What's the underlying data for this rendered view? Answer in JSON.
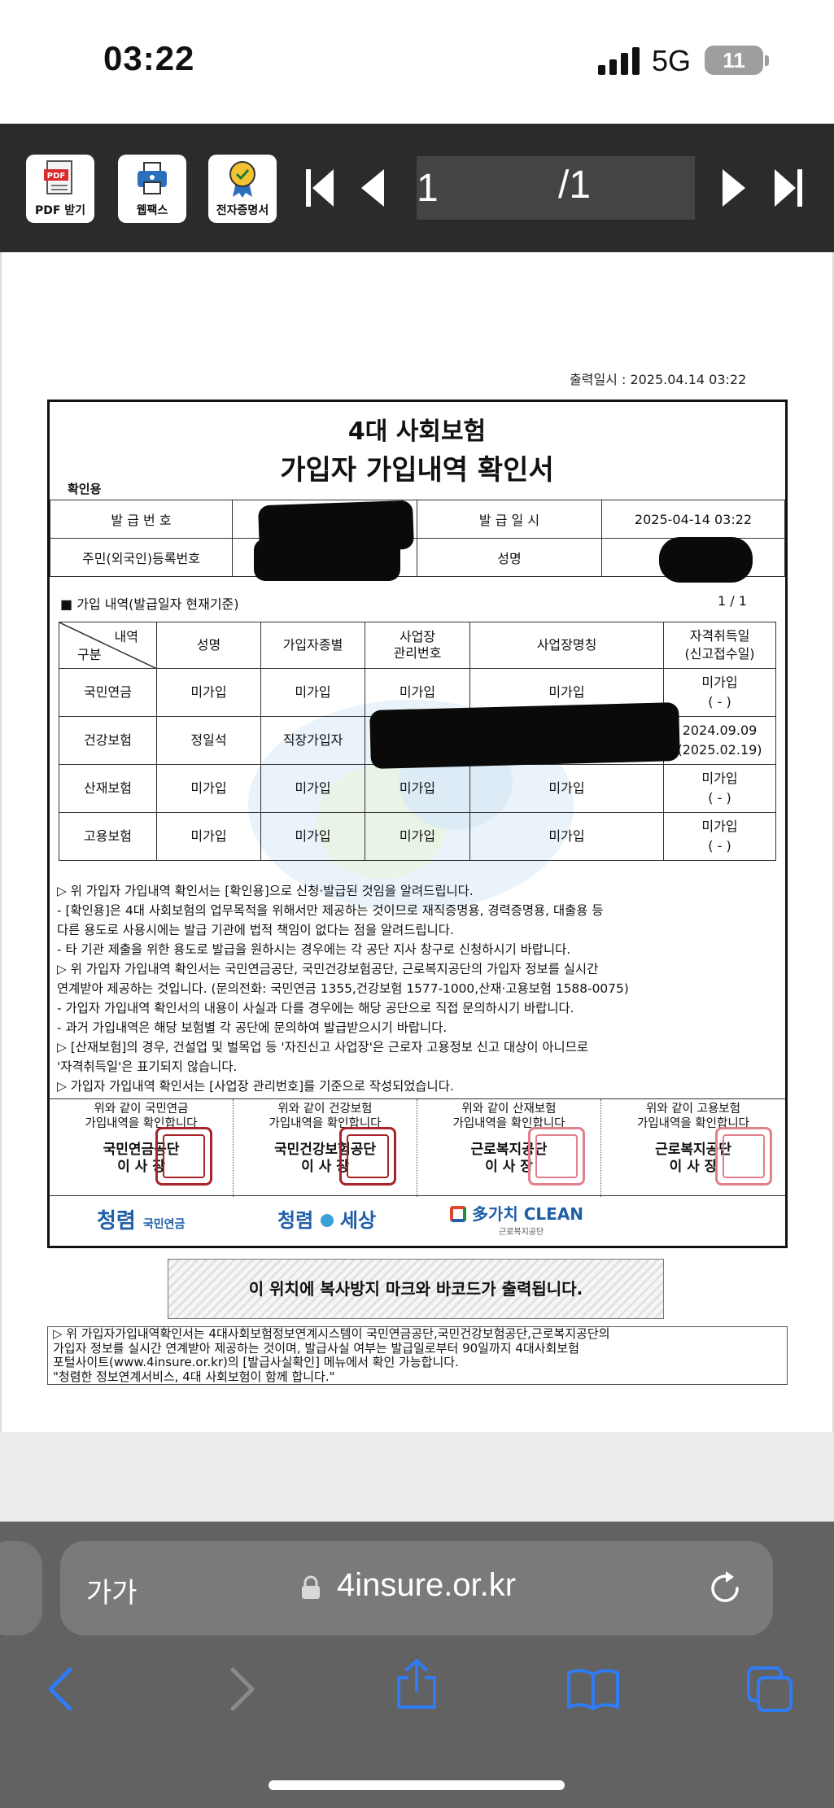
{
  "status_bar": {
    "time": "03:22",
    "network": "5G",
    "battery": "11"
  },
  "toolbar": {
    "pdf_label": "PDF 받기",
    "fax_label": "웹팩스",
    "cert_label": "전자증명서",
    "page_current": "1",
    "page_total": "/1"
  },
  "doc": {
    "print_date": "출력일시 : 2025.04.14 03:22",
    "title1": "4대 사회보험",
    "title2": "가입자 가입내역 확인서",
    "tag": "확인용",
    "info": {
      "issue_no_label": "발 급 번 호",
      "issue_date_label": "발 급 일 시",
      "issue_date": "2025-04-14 03:22",
      "reg_no_label": "주민(외국인)등록번호",
      "name_label": "성명"
    },
    "section_title": "■ 가입 내역(발급일자 현재기준)",
    "section_page": "1   /   1",
    "grid": {
      "corner_top": "내역",
      "corner_bottom": "구분",
      "headers": [
        "성명",
        "가입자종별",
        "사업장\n관리번호",
        "사업장명칭",
        "자격취득일\n(신고접수일)"
      ],
      "rows": [
        {
          "type": "국민연금",
          "name": "미가입",
          "kind": "미가입",
          "biz_no": "미가입",
          "biz_name": "미가입",
          "date1": "미가입",
          "date2": "( - )"
        },
        {
          "type": "건강보험",
          "name": "정일석",
          "kind": "직장가입자",
          "biz_no": "",
          "biz_name": "",
          "date1": "2024.09.09",
          "date2": "(2025.02.19)"
        },
        {
          "type": "산재보험",
          "name": "미가입",
          "kind": "미가입",
          "biz_no": "미가입",
          "biz_name": "미가입",
          "date1": "미가입",
          "date2": "( - )"
        },
        {
          "type": "고용보험",
          "name": "미가입",
          "kind": "미가입",
          "biz_no": "미가입",
          "biz_name": "미가입",
          "date1": "미가입",
          "date2": "( - )"
        }
      ]
    },
    "notes": [
      "▷ 위 가입자 가입내역 확인서는 [확인용]으로 신청·발급된 것임을 알려드립니다.",
      " - [확인용]은 4대 사회보험의 업무목적을 위해서만 제공하는 것이므로 재직증명용, 경력증명용, 대출용 등",
      "   다른 용도로 사용시에는 발급 기관에 법적 책임이 없다는 점을 알려드립니다.",
      " - 타 기관 제출을 위한 용도로 발급을 원하시는 경우에는 각 공단 지사 창구로 신청하시기 바랍니다.",
      "▷ 위 가입자 가입내역 확인서는 국민연금공단, 국민건강보험공단, 근로복지공단의 가입자 정보를 실시간",
      "   연계받아 제공하는 것입니다. (문의전화: 국민연금 1355,건강보험 1577-1000,산재·고용보험 1588-0075)",
      " - 가입자 가입내역 확인서의 내용이 사실과 다를 경우에는 해당 공단으로 직접 문의하시기 바랍니다.",
      " - 과거 가입내역은 해당 보험별 각 공단에 문의하여 발급받으시기 바랍니다.",
      "▷ [산재보험]의 경우, 건설업 및 벌목업 등 '자진신고 사업장'은 근로자 고용정보 신고 대상이 아니므로",
      "   '자격취득일'은 표기되지 않습니다.",
      "▷ 가입자 가입내역 확인서는 [사업장 관리번호]를 기준으로 작성되었습니다."
    ],
    "seals": [
      {
        "l1": "위와 같이 국민연금",
        "l2": "가입내역을 확인합니다",
        "org": "국민연금공단",
        "ceo": "이 사 장",
        "color": "#a8232a"
      },
      {
        "l1": "위와 같이 건강보험",
        "l2": "가입내역을 확인합니다",
        "org": "국민건강보험공단",
        "ceo": "이 사 장",
        "color": "#a8232a"
      },
      {
        "l1": "위와 같이 산재보험",
        "l2": "가입내역을 확인합니다",
        "org": "근로복지공단",
        "ceo": "이 사 장",
        "color": "#e0808c"
      },
      {
        "l1": "위와 같이 고용보험",
        "l2": "가입내역을 확인합니다",
        "org": "근로복지공단",
        "ceo": "이 사 장",
        "color": "#e0808c"
      }
    ],
    "logos": {
      "nps": "청렴",
      "nps_sub": "국민연금",
      "nhis": "청렴",
      "nhis_sub": "세상",
      "kcomwel": "多가치 CLEAN",
      "kcomwel_sub": "근로복지공단"
    },
    "copy_notice": "이 위치에 복사방지 마크와 바코드가 출력됩니다.",
    "footer": [
      "▷ 위 가입자가입내역확인서는 4대사회보험정보연계시스템이 국민연금공단,국민건강보험공단,근로복지공단의",
      "   가입자 정보를 실시간 연계받아 제공하는 것이며, 발급사실 여부는 발급일로부터 90일까지 4대사회보험",
      "   포털사이트(www.4insure.or.kr)의 [발급사실확인] 메뉴에서 확인 가능합니다.",
      "              \"청렴한 정보연계서비스, 4대 사회보험이 함께 합니다.\""
    ]
  },
  "browser": {
    "aa": "가가",
    "url": "4insure.or.kr"
  },
  "colors": {
    "toolbar": "#2b2b2b",
    "safari": "#626262",
    "accent": "#2f7bf6"
  }
}
